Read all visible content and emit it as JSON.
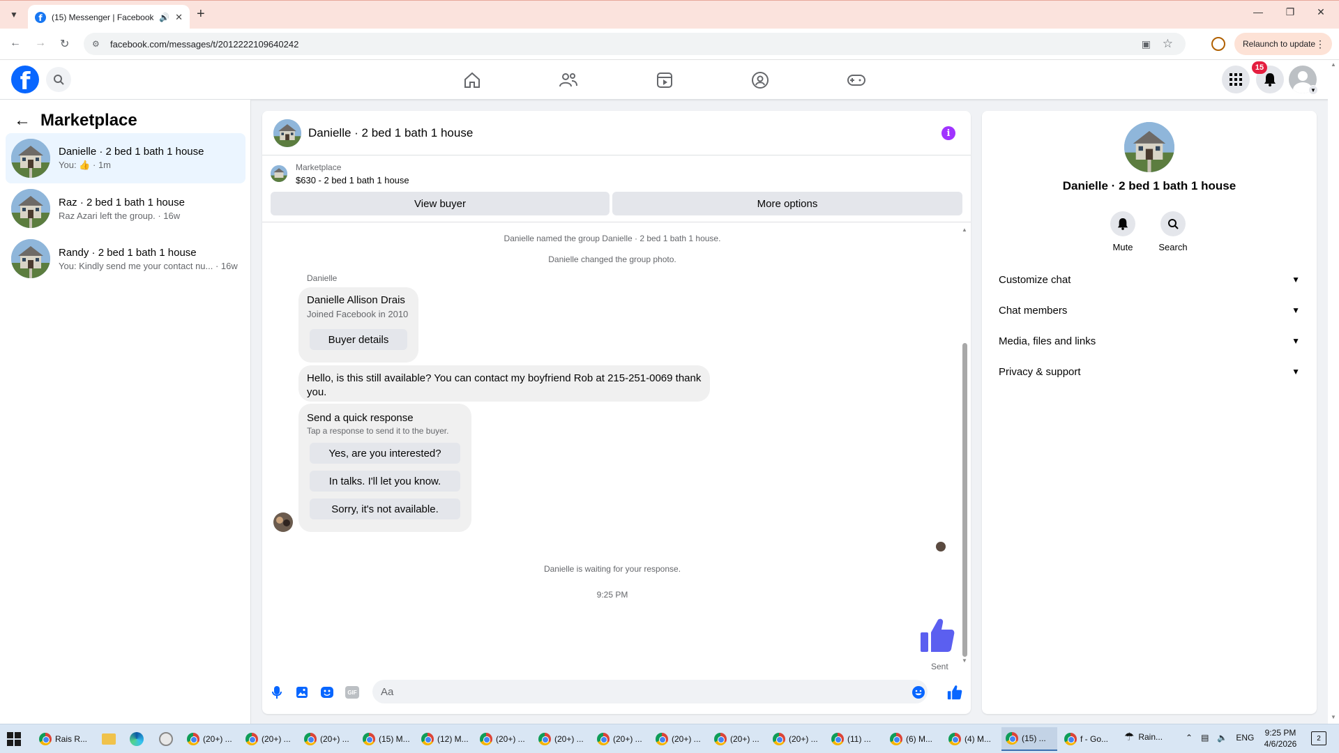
{
  "browser": {
    "tab_title": "(15) Messenger | Facebook",
    "url": "facebook.com/messages/t/2012222109640242",
    "relaunch_label": "Relaunch to update"
  },
  "fb_nav": {
    "notification_count": "15",
    "icons": [
      "home-icon",
      "friends-icon",
      "video-icon",
      "groups-icon",
      "gaming-icon"
    ],
    "accent_color": "#0866ff"
  },
  "left_panel": {
    "title": "Marketplace",
    "conversations": [
      {
        "title": "Danielle · 2 bed 1 bath 1 house",
        "sub_prefix": "You:",
        "sub_suffix": "· 1m"
      },
      {
        "title": "Raz · 2 bed 1 bath 1 house",
        "sub": "Raz Azari left the group. · 16w"
      },
      {
        "title": "Randy · 2 bed 1 bath 1 house",
        "sub": "You: Kindly send me your contact nu... · 16w"
      }
    ]
  },
  "chat": {
    "title": "Danielle · 2 bed 1 bath 1 house",
    "listing": {
      "label": "Marketplace",
      "price_line": "$630 - 2 bed 1 bath 1 house",
      "view_buyer": "View buyer",
      "more_options": "More options"
    },
    "system_messages": [
      "Danielle named the group Danielle · 2 bed 1 bath 1 house.",
      "Danielle changed the group photo."
    ],
    "sender_name": "Danielle",
    "card": {
      "name": "Danielle Allison Drais",
      "joined": "Joined Facebook in 2010",
      "button": "Buyer details"
    },
    "message_text": "Hello, is this still available? You can contact my boyfriend Rob at 215-251-0069 thank you.",
    "quick_response": {
      "title": "Send a quick response",
      "subtitle": "Tap a response to send it to the buyer.",
      "options": [
        "Yes, are you interested?",
        "In talks. I'll let you know.",
        "Sorry, it's not available."
      ]
    },
    "waiting_text": "Danielle is waiting for your response.",
    "timestamp": "9:25 PM",
    "sent_label": "Sent",
    "composer_placeholder": "Aa",
    "gif_label": "GIF"
  },
  "info_panel": {
    "title": "Danielle · 2 bed 1 bath 1 house",
    "actions": [
      "Mute",
      "Search"
    ],
    "sections": [
      "Customize chat",
      "Chat members",
      "Media, files and links",
      "Privacy & support"
    ]
  },
  "taskbar": {
    "items": [
      {
        "label": "Rais R...",
        "icon": "chrome-icon"
      },
      {
        "label": "",
        "icon": "file-explorer-icon"
      },
      {
        "label": "",
        "icon": "edge-icon"
      },
      {
        "label": "",
        "icon": "paint-icon"
      },
      {
        "label": "(20+) ...",
        "icon": "chrome-icon"
      },
      {
        "label": "(20+) ...",
        "icon": "chrome-icon"
      },
      {
        "label": "(20+) ...",
        "icon": "chrome-icon"
      },
      {
        "label": "(15) M...",
        "icon": "chrome-icon"
      },
      {
        "label": "(12) M...",
        "icon": "chrome-icon"
      },
      {
        "label": "(20+) ...",
        "icon": "chrome-icon"
      },
      {
        "label": "(20+) ...",
        "icon": "chrome-icon"
      },
      {
        "label": "(20+) ...",
        "icon": "chrome-icon"
      },
      {
        "label": "(20+) ...",
        "icon": "chrome-icon"
      },
      {
        "label": "(20+) ...",
        "icon": "chrome-icon"
      },
      {
        "label": "(20+) ...",
        "icon": "chrome-icon"
      },
      {
        "label": "(11) ...",
        "icon": "chrome-icon"
      },
      {
        "label": "(6) M...",
        "icon": "chrome-icon"
      },
      {
        "label": "(4) M...",
        "icon": "chrome-icon"
      },
      {
        "label": "(15) ...",
        "icon": "chrome-icon"
      },
      {
        "label": "f - Go...",
        "icon": "chrome-icon"
      }
    ],
    "weather": "Rain...",
    "language": "ENG",
    "time": "9:25 PM",
    "date": "4/6/2026",
    "notifications": "2"
  }
}
